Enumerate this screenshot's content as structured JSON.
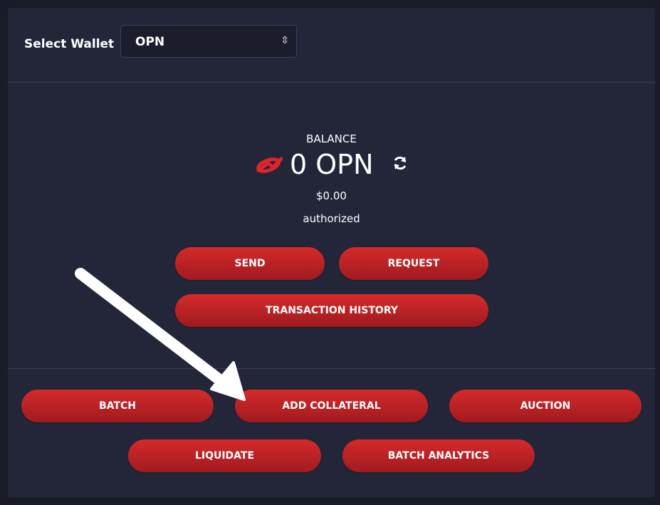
{
  "wallet": {
    "label": "Select Wallet",
    "selected": "OPN"
  },
  "balance": {
    "label": "BALANCE",
    "amount": "0 OPN",
    "usd": "$0.00",
    "status": "authorized"
  },
  "actions": {
    "send": "SEND",
    "request": "REQUEST",
    "history": "TRANSACTION HISTORY"
  },
  "batch_actions": {
    "batch": "BATCH",
    "add_collateral": "ADD COLLATERAL",
    "auction": "AUCTION",
    "liquidate": "LIQUIDATE",
    "batch_analytics": "BATCH ANALYTICS"
  },
  "colors": {
    "background": "#191b28",
    "panel": "#232639",
    "button_top": "#d52b2b",
    "button_bottom": "#a01a1f",
    "logo": "#e0242b"
  },
  "icons": {
    "logo": "opn-logo-icon",
    "refresh": "refresh-icon",
    "select_arrow": "up-down-arrow-icon",
    "annotation": "pointer-arrow-icon"
  }
}
